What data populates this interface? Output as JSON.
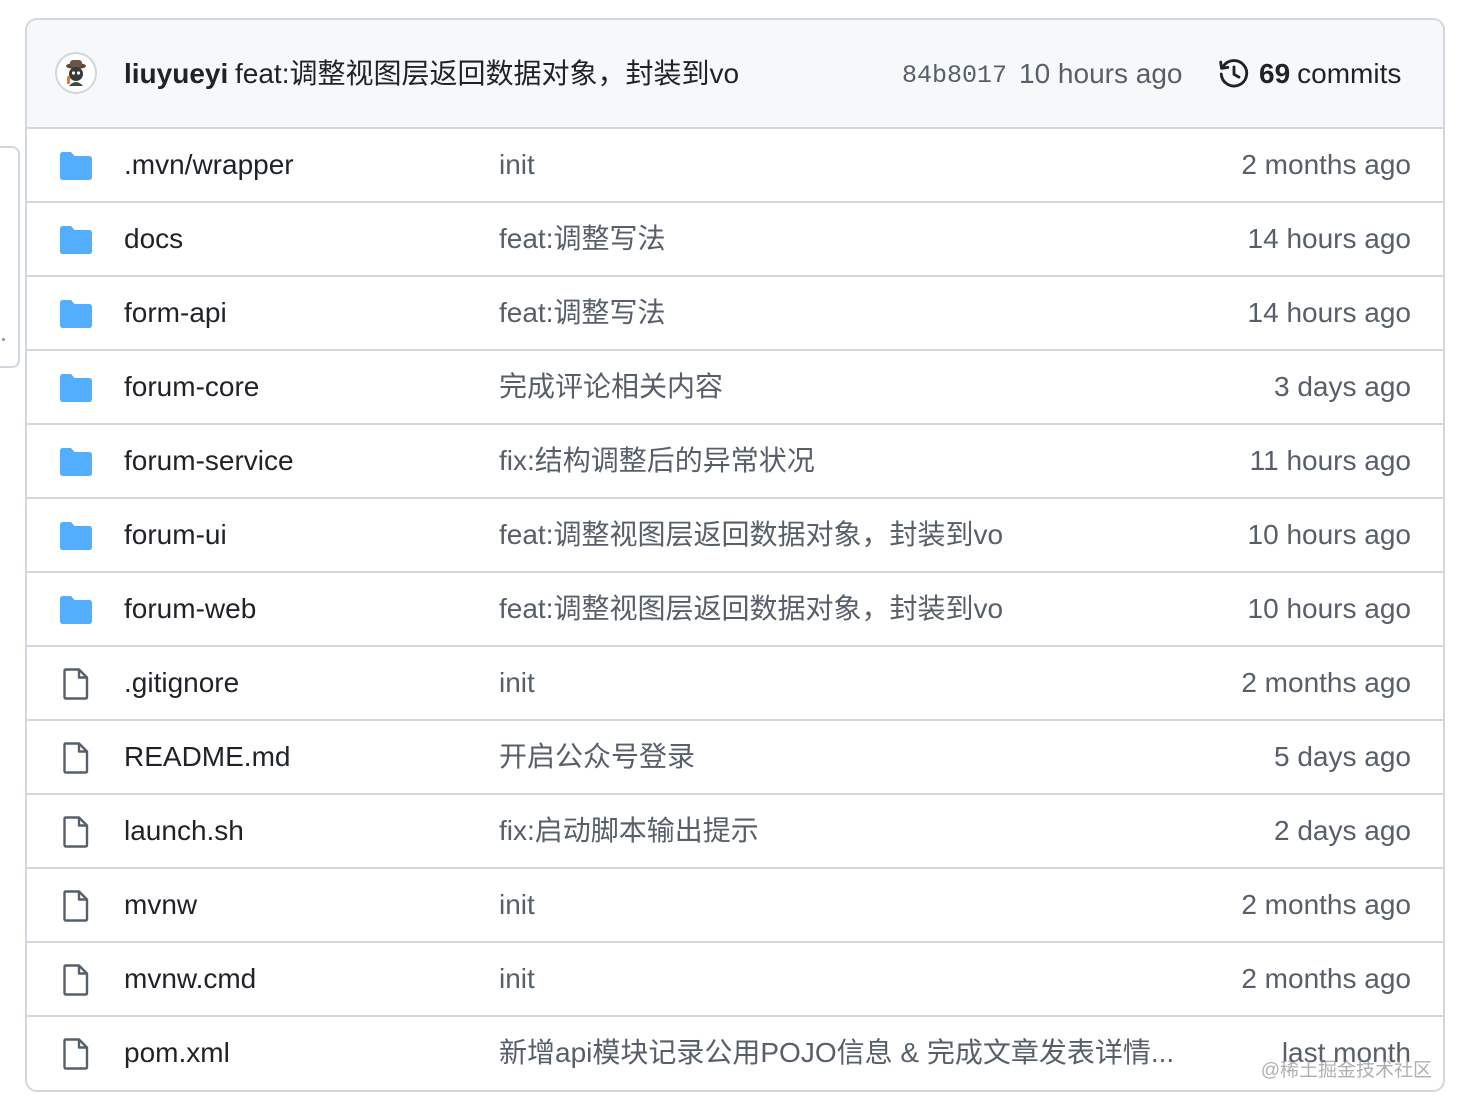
{
  "latest_commit": {
    "author": "liuyueyi",
    "message": "feat:调整视图层返回数据对象，封装到vo",
    "sha": "84b8017",
    "time": "10 hours ago",
    "commits_count": "69",
    "commits_label": "commits",
    "avatar_icon": "avatar-icon",
    "history_icon": "history-icon"
  },
  "colors": {
    "folder": "#54aeff",
    "file_icon": "#57606a",
    "border": "#d0d7de",
    "header_bg": "#f6f8fa",
    "text": "#1f2328",
    "muted": "#57606a"
  },
  "files": [
    {
      "type": "dir",
      "icon": "folder-icon",
      "name": ".mvn/wrapper",
      "message": "init",
      "time": "2 months ago"
    },
    {
      "type": "dir",
      "icon": "folder-icon",
      "name": "docs",
      "message": "feat:调整写法",
      "time": "14 hours ago"
    },
    {
      "type": "dir",
      "icon": "folder-icon",
      "name": "form-api",
      "message": "feat:调整写法",
      "time": "14 hours ago"
    },
    {
      "type": "dir",
      "icon": "folder-icon",
      "name": "forum-core",
      "message": "完成评论相关内容",
      "time": "3 days ago"
    },
    {
      "type": "dir",
      "icon": "folder-icon",
      "name": "forum-service",
      "message": "fix:结构调整后的异常状况",
      "time": "11 hours ago"
    },
    {
      "type": "dir",
      "icon": "folder-icon",
      "name": "forum-ui",
      "message": "feat:调整视图层返回数据对象，封装到vo",
      "time": "10 hours ago"
    },
    {
      "type": "dir",
      "icon": "folder-icon",
      "name": "forum-web",
      "message": "feat:调整视图层返回数据对象，封装到vo",
      "time": "10 hours ago"
    },
    {
      "type": "file",
      "icon": "file-icon",
      "name": ".gitignore",
      "message": "init",
      "time": "2 months ago"
    },
    {
      "type": "file",
      "icon": "file-icon",
      "name": "README.md",
      "message": "开启公众号登录",
      "time": "5 days ago"
    },
    {
      "type": "file",
      "icon": "file-icon",
      "name": "launch.sh",
      "message": "fix:启动脚本输出提示",
      "time": "2 days ago"
    },
    {
      "type": "file",
      "icon": "file-icon",
      "name": "mvnw",
      "message": "init",
      "time": "2 months ago"
    },
    {
      "type": "file",
      "icon": "file-icon",
      "name": "mvnw.cmd",
      "message": "init",
      "time": "2 months ago"
    },
    {
      "type": "file",
      "icon": "file-icon",
      "name": "pom.xml",
      "message": "新增api模块记录公用POJO信息 & 完成文章发表详情...",
      "time": "last month"
    }
  ],
  "watermark": "@稀土掘金技术社区"
}
